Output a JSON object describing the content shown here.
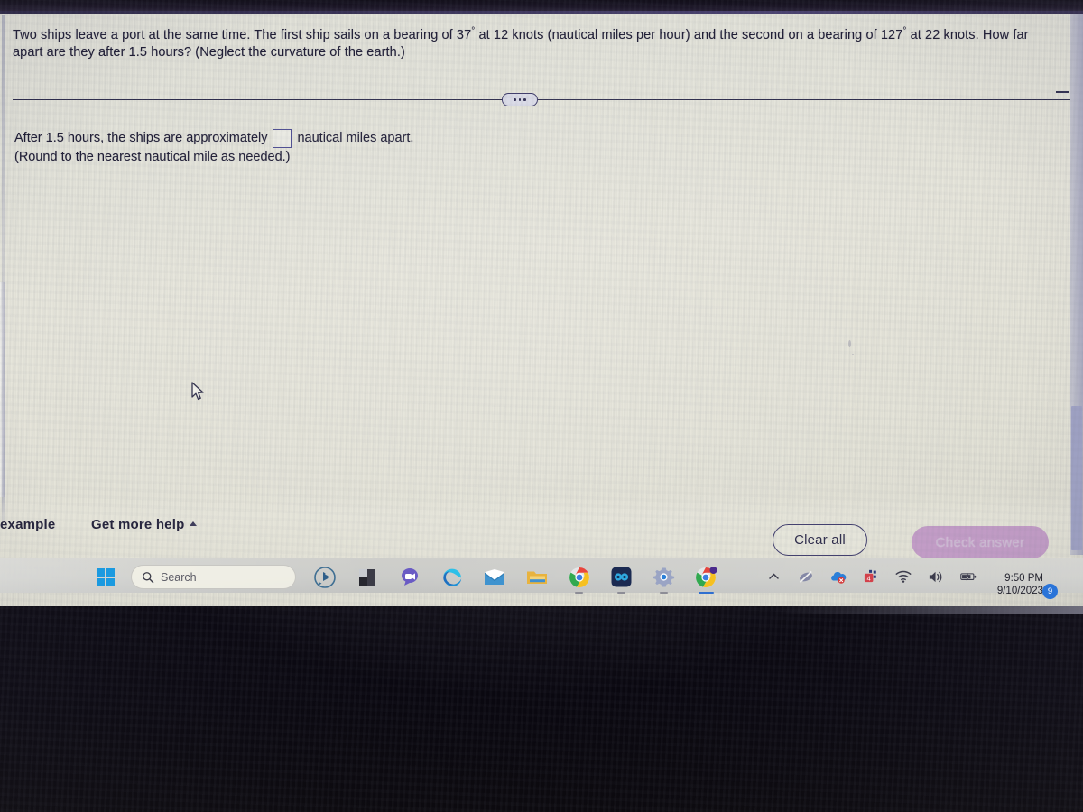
{
  "exercise": {
    "question_part1": "Two ships leave a port at the same time. The first ship sails on a bearing of 37",
    "question_deg1": "°",
    "question_part2": " at 12 knots (nautical miles per hour) and the second on a bearing of 127",
    "question_deg2": "°",
    "question_part3": " at 22 knots. How far apart are they after 1.5 hours? (Neglect the curvature of the earth.)",
    "answer_prefix": "After 1.5 hours, the ships are approximately",
    "answer_suffix": "nautical miles apart.",
    "answer_value": "",
    "rounding_note": "(Round to the nearest nautical mile as needed.)",
    "more_options_label": "•••"
  },
  "footer": {
    "example_label": "example",
    "get_more_help_label": "Get more help",
    "clear_all_label": "Clear all",
    "check_answer_label": "Check answer"
  },
  "taskbar": {
    "search_placeholder": "Search",
    "apps": [
      {
        "name": "bing-chat",
        "label": "Bing Chat"
      },
      {
        "name": "task-view",
        "label": "Task View"
      },
      {
        "name": "teams-chat",
        "label": "Chat"
      },
      {
        "name": "microsoft-edge",
        "label": "Microsoft Edge"
      },
      {
        "name": "mail",
        "label": "Mail"
      },
      {
        "name": "file-explorer",
        "label": "File Explorer"
      },
      {
        "name": "google-chrome",
        "label": "Google Chrome"
      },
      {
        "name": "blue-app",
        "label": "App"
      },
      {
        "name": "settings",
        "label": "Settings"
      },
      {
        "name": "google-chrome-active",
        "label": "Google Chrome"
      }
    ],
    "tray": [
      {
        "name": "show-hidden-icons",
        "label": "Show hidden icons"
      },
      {
        "name": "pen-disabled",
        "label": "Pen menu off"
      },
      {
        "name": "onedrive-error",
        "label": "OneDrive"
      },
      {
        "name": "teams-badge",
        "label": "Teams"
      },
      {
        "name": "wifi",
        "label": "Network"
      },
      {
        "name": "volume",
        "label": "Volume"
      },
      {
        "name": "battery-charging",
        "label": "Battery charging"
      }
    ],
    "time": "9:50 PM",
    "date": "9/10/2023",
    "notification_count": "9"
  },
  "colors": {
    "accent_blue": "#2a74d8",
    "check_answer_bg": "#c29cc6",
    "text": "#1d1b33",
    "screen_bg": "#e3e2d7"
  }
}
